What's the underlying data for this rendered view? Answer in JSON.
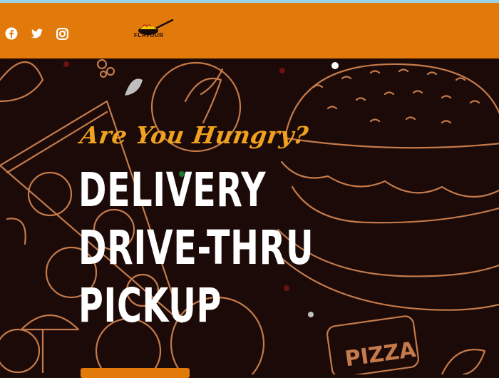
{
  "header": {
    "brand": "FLAVOUR",
    "social": [
      {
        "icon": "facebook-icon"
      },
      {
        "icon": "twitter-icon"
      },
      {
        "icon": "instagram-icon"
      }
    ]
  },
  "hero": {
    "tagline": "Are You Hungry?",
    "lines": [
      "DELIVERY",
      "DRIVE-THRU",
      "PICKUP"
    ],
    "pizza_sign": "PIZZA"
  },
  "colors": {
    "accent": "#e27a0b",
    "tagline": "#f0a21f",
    "background": "#1a0b08",
    "sketch": "#c47a4b",
    "top_strip": "#9bd3e6"
  }
}
